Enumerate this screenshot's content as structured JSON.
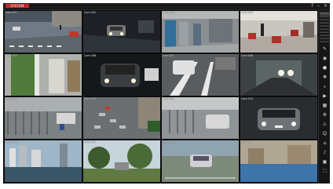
{
  "app": {
    "logo": "SYSTEM"
  },
  "window_controls": {
    "help": "?",
    "minimize": "–",
    "close": "×"
  },
  "cameras": [
    {
      "label": "Cam 001"
    },
    {
      "label": "Cam 002"
    },
    {
      "label": "Cam 003"
    },
    {
      "label": "Cam 004"
    },
    {
      "label": "Cam 005"
    },
    {
      "label": "Cam 006"
    },
    {
      "label": "Cam 007"
    },
    {
      "label": "Cam 008"
    },
    {
      "label": "Cam 009"
    },
    {
      "label": "Cam 010"
    },
    {
      "label": "Cam 011"
    },
    {
      "label": "Cam 012"
    },
    {
      "label": "Cam 013"
    },
    {
      "label": "Cam 014"
    },
    {
      "label": "Cam 015"
    },
    {
      "label": "Cam 016"
    }
  ],
  "sidebar": {
    "list_items": [
      "Camera 01",
      "Camera 02",
      "Camera 03",
      "Camera 04",
      "Camera 05",
      "Camera 06",
      "Camera 07",
      "Camera 08",
      "Camera 09",
      "Camera 10"
    ],
    "tools": [
      {
        "icon": "pencil-icon",
        "glyph": "✎"
      },
      {
        "icon": "camera-icon",
        "glyph": "◉"
      },
      {
        "icon": "record-icon",
        "glyph": "●"
      },
      {
        "icon": "ptz-icon",
        "glyph": "✥"
      },
      {
        "icon": "search-icon",
        "glyph": "⌕"
      },
      {
        "icon": "play-icon",
        "glyph": "▶"
      },
      {
        "icon": "layout-icon",
        "glyph": "▦"
      },
      {
        "icon": "settings-icon",
        "glyph": "⚙"
      },
      {
        "icon": "alarm-icon",
        "glyph": "⚠"
      },
      {
        "icon": "user-icon",
        "glyph": "☺"
      },
      {
        "icon": "map-icon",
        "glyph": "⌂"
      },
      {
        "icon": "audio-icon",
        "glyph": "♪"
      },
      {
        "icon": "snapshot-icon",
        "glyph": "▣"
      },
      {
        "icon": "fullscreen-icon",
        "glyph": "⛶"
      }
    ]
  },
  "colors": {
    "accent": "#c62828",
    "background": "#0c0c0c",
    "panel": "#161616"
  }
}
